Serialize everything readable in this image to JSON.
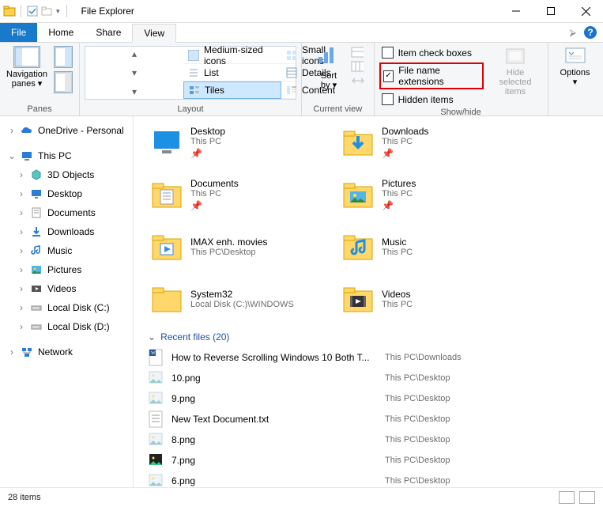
{
  "window": {
    "title": "File Explorer",
    "minimize": "Minimize",
    "maximize": "Maximize",
    "close": "Close"
  },
  "menu": {
    "file": "File",
    "home": "Home",
    "share": "Share",
    "view": "View"
  },
  "ribbon": {
    "panes": {
      "navpane": "Navigation",
      "navpane2": "panes ▾",
      "group": "Panes"
    },
    "layout": {
      "medium": "Medium-sized icons",
      "small": "Small icons",
      "list": "List",
      "details": "Details",
      "tiles": "Tiles",
      "content": "Content",
      "group": "Layout"
    },
    "currentview": {
      "sort": "Sort",
      "sort2": "by ▾",
      "group": "Current view"
    },
    "showhide": {
      "itemcheck": "Item check boxes",
      "fileext": "File name extensions",
      "hidden": "Hidden items",
      "hidesel": "Hide selected",
      "hidesel2": "items",
      "group": "Show/hide"
    },
    "options": {
      "label": "Options",
      "caret": "▾"
    }
  },
  "nav": {
    "onedrive": "OneDrive - Personal",
    "thispc": "This PC",
    "obj3d": "3D Objects",
    "desktop": "Desktop",
    "documents": "Documents",
    "downloads": "Downloads",
    "music": "Music",
    "pictures": "Pictures",
    "videos": "Videos",
    "localc": "Local Disk (C:)",
    "locald": "Local Disk (D:)",
    "network": "Network"
  },
  "tiles": [
    {
      "name": "Desktop",
      "loc": "This PC",
      "icon": "desktop",
      "pin": true
    },
    {
      "name": "Downloads",
      "loc": "This PC",
      "icon": "downloads",
      "pin": true
    },
    {
      "name": "Documents",
      "loc": "This PC",
      "icon": "documents",
      "pin": true
    },
    {
      "name": "Pictures",
      "loc": "This PC",
      "icon": "pictures",
      "pin": true
    },
    {
      "name": "IMAX enh. movies",
      "loc": "This PC\\Desktop",
      "icon": "video",
      "pin": false
    },
    {
      "name": "Music",
      "loc": "This PC",
      "icon": "music",
      "pin": false
    },
    {
      "name": "System32",
      "loc": "Local Disk (C:)\\WINDOWS",
      "icon": "folder",
      "pin": false
    },
    {
      "name": "Videos",
      "loc": "This PC",
      "icon": "videos",
      "pin": false
    }
  ],
  "recent": {
    "header": "Recent files (20)",
    "files": [
      {
        "name": "How to Reverse Scrolling Windows 10 Both T...",
        "loc": "This PC\\Downloads",
        "icon": "word"
      },
      {
        "name": "10.png",
        "loc": "This PC\\Desktop",
        "icon": "png"
      },
      {
        "name": "9.png",
        "loc": "This PC\\Desktop",
        "icon": "png"
      },
      {
        "name": "New Text Document.txt",
        "loc": "This PC\\Desktop",
        "icon": "txt"
      },
      {
        "name": "8.png",
        "loc": "This PC\\Desktop",
        "icon": "png"
      },
      {
        "name": "7.png",
        "loc": "This PC\\Desktop",
        "icon": "png-dark"
      },
      {
        "name": "6.png",
        "loc": "This PC\\Desktop",
        "icon": "png"
      }
    ]
  },
  "status": {
    "items": "28 items"
  }
}
